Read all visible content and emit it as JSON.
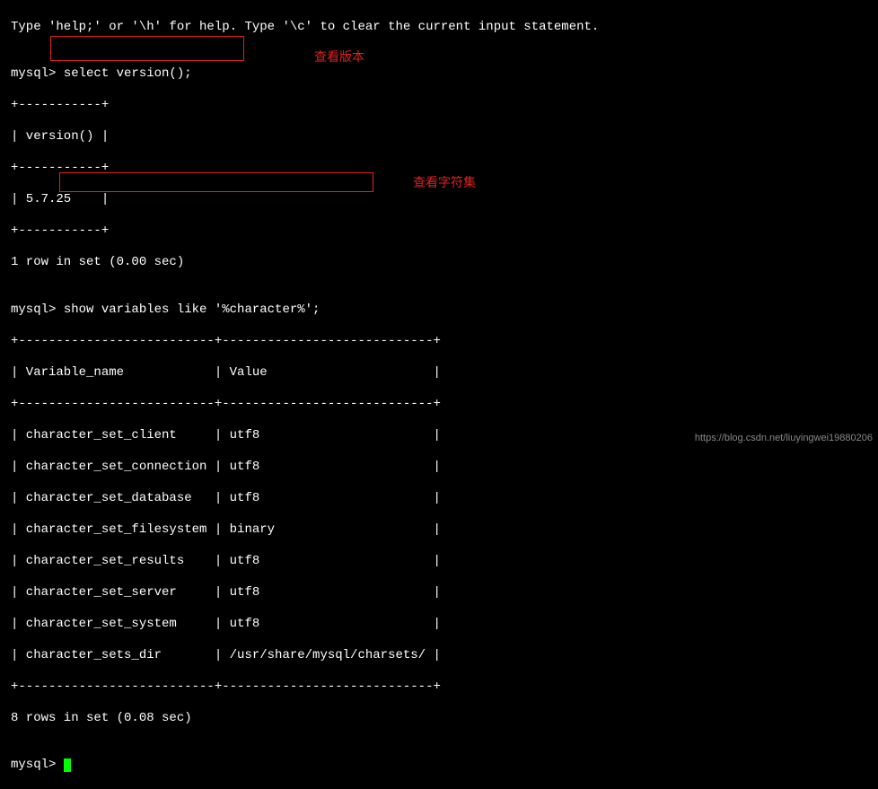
{
  "help_line": "Type 'help;' or '\\h' for help. Type '\\c' to clear the current input statement.",
  "blank": "",
  "prompt": "mysql> ",
  "query1": "select version();",
  "table1": {
    "sep": "+-----------+",
    "head": "| version() |",
    "row": "| 5.7.25    |"
  },
  "result1_summary": "1 row in set (0.00 sec)",
  "query2": "show variables like '%character%';",
  "table2": {
    "sep": "+--------------------------+----------------------------+",
    "head": "| Variable_name            | Value                      |",
    "rows": [
      "| character_set_client     | utf8                       |",
      "| character_set_connection | utf8                       |",
      "| character_set_database   | utf8                       |",
      "| character_set_filesystem | binary                     |",
      "| character_set_results    | utf8                       |",
      "| character_set_server     | utf8                       |",
      "| character_set_system     | utf8                       |",
      "| character_sets_dir       | /usr/share/mysql/charsets/ |"
    ]
  },
  "result2_summary": "8 rows in set (0.08 sec)",
  "annotations": {
    "a1": "查看版本",
    "a2": "查看字符集"
  },
  "watermark": "https://blog.csdn.net/liuyingwei19880206"
}
